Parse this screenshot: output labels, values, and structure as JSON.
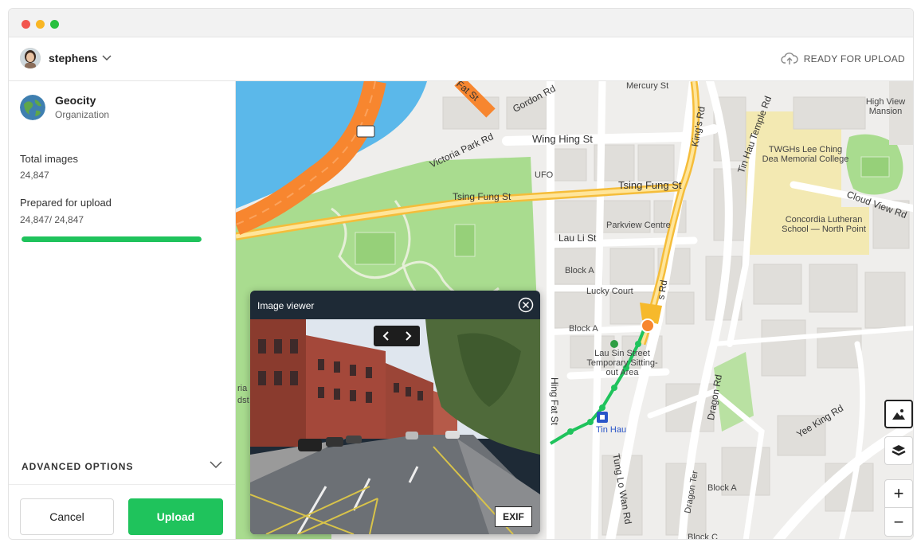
{
  "header": {
    "user_name": "stephens",
    "status": "READY FOR UPLOAD"
  },
  "sidebar": {
    "org_name": "Geocity",
    "org_type": "Organization",
    "total_images_label": "Total images",
    "total_images_value": "24,847",
    "prepared_label": "Prepared for upload",
    "prepared_value": "24,847/ 24,847",
    "progress_fraction": 1.0,
    "advanced_options_label": "ADVANCED OPTIONS",
    "cancel_label": "Cancel",
    "upload_label": "Upload"
  },
  "viewer": {
    "title": "Image viewer",
    "exif_label": "EXIF"
  },
  "map": {
    "labels": [
      "Mercury St",
      "Gordon Rd",
      "Fat St",
      "Victoria Park Rd",
      "Wing Hing St",
      "UFO",
      "Tsing Fung St",
      "Tsing Fung St",
      "King's Rd",
      "Tin Hau Temple Rd",
      "High View Mansion",
      "TWGHs Lee Ching Dea Memorial College",
      "Cloud View Rd",
      "Concordia Lutheran School — North Point",
      "Parkview Centre",
      "Lau Li St",
      "Block A",
      "Lucky Court",
      "Block A",
      "s Rd",
      "Lau Sin Street Temporary Sitting-out Area",
      "Tin Hau",
      "Hing Fat St",
      "Dragon Rd",
      "Yee King Rd",
      "Tung Lo Wan Rd",
      "Dragon Ter",
      "Block A",
      "Block C",
      "ria",
      "dst"
    ],
    "zoom_in": "+",
    "zoom_out": "−"
  },
  "colors": {
    "accent_green": "#1fc35c",
    "highway_orange": "#f7862f",
    "water_blue": "#5bb8ea",
    "park_green": "#a9dc8f"
  }
}
